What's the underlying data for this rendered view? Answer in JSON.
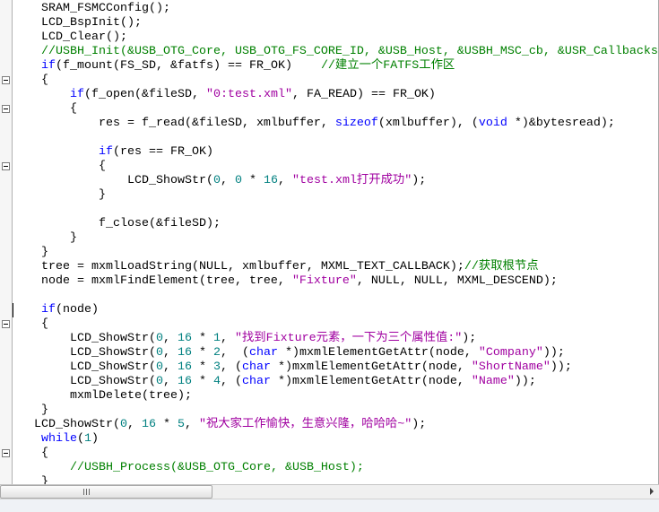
{
  "editor": {
    "theme": {
      "background": "#ffffff",
      "plain": "#000000",
      "keyword": "#0000ff",
      "number": "#008080",
      "string": "#a000a0",
      "comment": "#008000"
    },
    "caret": {
      "line": 21,
      "column": 0
    },
    "lines": [
      {
        "tokens": [
          {
            "plain": "    SRAM_FSMCConfig();"
          }
        ]
      },
      {
        "tokens": [
          {
            "plain": "    LCD_BspInit();"
          }
        ]
      },
      {
        "tokens": [
          {
            "plain": "    LCD_Clear();"
          }
        ]
      },
      {
        "tokens": [
          {
            "plain": "    "
          },
          {
            "comment": "//USBH_Init(&USB_OTG_Core, USB_OTG_FS_CORE_ID, &USB_Host, &USBH_MSC_cb, &USR_Callbacks"
          }
        ]
      },
      {
        "tokens": [
          {
            "plain": "    "
          },
          {
            "keyword": "if"
          },
          {
            "plain": "(f_mount(FS_SD, &fatfs) == FR_OK)    "
          },
          {
            "comment": "//建立一个FATFS工作区"
          }
        ]
      },
      {
        "fold": true,
        "tokens": [
          {
            "plain": "    {"
          }
        ]
      },
      {
        "tokens": [
          {
            "plain": "        "
          },
          {
            "keyword": "if"
          },
          {
            "plain": "(f_open(&fileSD, "
          },
          {
            "string": "\"0:test.xml\""
          },
          {
            "plain": ", FA_READ) == FR_OK)"
          }
        ]
      },
      {
        "fold": true,
        "tokens": [
          {
            "plain": "        {"
          }
        ]
      },
      {
        "tokens": [
          {
            "plain": "            res = f_read(&fileSD, xmlbuffer, "
          },
          {
            "keyword": "sizeof"
          },
          {
            "plain": "(xmlbuffer), ("
          },
          {
            "keyword": "void"
          },
          {
            "plain": " *)&bytesread);"
          }
        ]
      },
      {
        "tokens": []
      },
      {
        "tokens": [
          {
            "plain": "            "
          },
          {
            "keyword": "if"
          },
          {
            "plain": "(res == FR_OK)"
          }
        ]
      },
      {
        "fold": true,
        "tokens": [
          {
            "plain": "            {"
          }
        ]
      },
      {
        "tokens": [
          {
            "plain": "                LCD_ShowStr("
          },
          {
            "number": "0"
          },
          {
            "plain": ", "
          },
          {
            "number": "0"
          },
          {
            "plain": " * "
          },
          {
            "number": "16"
          },
          {
            "plain": ", "
          },
          {
            "string": "\"test.xml打开成功\""
          },
          {
            "plain": ");"
          }
        ]
      },
      {
        "tokens": [
          {
            "plain": "            }"
          }
        ]
      },
      {
        "tokens": []
      },
      {
        "tokens": [
          {
            "plain": "            f_close(&fileSD);"
          }
        ]
      },
      {
        "tokens": [
          {
            "plain": "        }"
          }
        ]
      },
      {
        "tokens": [
          {
            "plain": "    }"
          }
        ]
      },
      {
        "tokens": [
          {
            "plain": "    tree = mxmlLoadString(NULL, xmlbuffer, MXML_TEXT_CALLBACK);"
          },
          {
            "comment": "//获取根节点"
          }
        ]
      },
      {
        "tokens": [
          {
            "plain": "    node = mxmlFindElement(tree, tree, "
          },
          {
            "string": "\"Fixture\""
          },
          {
            "plain": ", NULL, NULL, MXML_DESCEND);"
          }
        ]
      },
      {
        "tokens": []
      },
      {
        "tokens": [
          {
            "plain": "    "
          },
          {
            "keyword": "if"
          },
          {
            "plain": "(node)"
          }
        ]
      },
      {
        "fold": true,
        "tokens": [
          {
            "plain": "    {"
          }
        ]
      },
      {
        "tokens": [
          {
            "plain": "        LCD_ShowStr("
          },
          {
            "number": "0"
          },
          {
            "plain": ", "
          },
          {
            "number": "16"
          },
          {
            "plain": " * "
          },
          {
            "number": "1"
          },
          {
            "plain": ", "
          },
          {
            "string": "\"找到Fixture元素，一下为三个属性值:\""
          },
          {
            "plain": ");"
          }
        ]
      },
      {
        "tokens": [
          {
            "plain": "        LCD_ShowStr("
          },
          {
            "number": "0"
          },
          {
            "plain": ", "
          },
          {
            "number": "16"
          },
          {
            "plain": " * "
          },
          {
            "number": "2"
          },
          {
            "plain": ",  ("
          },
          {
            "keyword": "char"
          },
          {
            "plain": " *)mxmlElementGetAttr(node, "
          },
          {
            "string": "\"Company\""
          },
          {
            "plain": "));"
          }
        ]
      },
      {
        "tokens": [
          {
            "plain": "        LCD_ShowStr("
          },
          {
            "number": "0"
          },
          {
            "plain": ", "
          },
          {
            "number": "16"
          },
          {
            "plain": " * "
          },
          {
            "number": "3"
          },
          {
            "plain": ", ("
          },
          {
            "keyword": "char"
          },
          {
            "plain": " *)mxmlElementGetAttr(node, "
          },
          {
            "string": "\"ShortName\""
          },
          {
            "plain": "));"
          }
        ]
      },
      {
        "tokens": [
          {
            "plain": "        LCD_ShowStr("
          },
          {
            "number": "0"
          },
          {
            "plain": ", "
          },
          {
            "number": "16"
          },
          {
            "plain": " * "
          },
          {
            "number": "4"
          },
          {
            "plain": ", ("
          },
          {
            "keyword": "char"
          },
          {
            "plain": " *)mxmlElementGetAttr(node, "
          },
          {
            "string": "\"Name\""
          },
          {
            "plain": "));"
          }
        ]
      },
      {
        "tokens": [
          {
            "plain": "        mxmlDelete(tree);"
          }
        ]
      },
      {
        "tokens": [
          {
            "plain": "    }"
          }
        ]
      },
      {
        "tokens": [
          {
            "plain": "   LCD_ShowStr("
          },
          {
            "number": "0"
          },
          {
            "plain": ", "
          },
          {
            "number": "16"
          },
          {
            "plain": " * "
          },
          {
            "number": "5"
          },
          {
            "plain": ", "
          },
          {
            "string": "\"祝大家工作愉快，生意兴隆，哈哈哈~\""
          },
          {
            "plain": ");"
          }
        ]
      },
      {
        "tokens": [
          {
            "plain": "    "
          },
          {
            "keyword": "while"
          },
          {
            "plain": "("
          },
          {
            "number": "1"
          },
          {
            "plain": ")"
          }
        ]
      },
      {
        "fold": true,
        "tokens": [
          {
            "plain": "    {"
          }
        ]
      },
      {
        "tokens": [
          {
            "plain": "        "
          },
          {
            "comment": "//USBH_Process(&USB_OTG_Core, &USB_Host);"
          }
        ]
      },
      {
        "tokens": [
          {
            "plain": "    }"
          }
        ]
      }
    ]
  },
  "icons": {
    "fold": "fold-collapse-icon",
    "scroll_grip": "scroll-grip-icon",
    "scroll_right": "arrow-right-icon"
  }
}
